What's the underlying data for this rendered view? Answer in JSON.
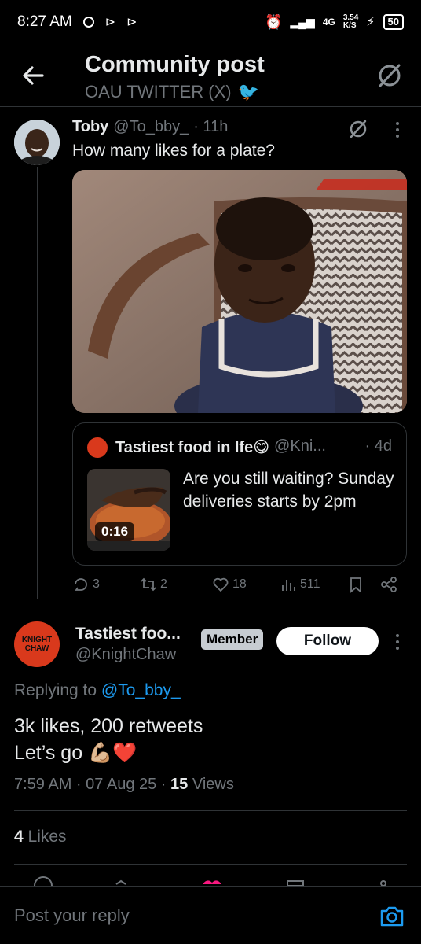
{
  "status_bar": {
    "time": "8:27 AM",
    "network": "4G",
    "speed": "3.54",
    "speed_unit": "K/S",
    "battery": "50"
  },
  "header": {
    "title": "Community post",
    "community": "OAU TWITTER (X)",
    "community_emoji": "🐦"
  },
  "tweet": {
    "name": "Toby",
    "handle": "@To_bby_",
    "time": "· 11h",
    "text": "How many likes for a plate?",
    "quote": {
      "name": "Tastiest food in Ife😋",
      "handle": "@Kni...",
      "time": "· 4d",
      "text": "Are you still waiting? Sunday deliveries starts by 2pm",
      "video_duration": "0:16"
    },
    "stats": {
      "replies": "3",
      "retweets": "2",
      "likes": "18",
      "views": "511"
    }
  },
  "reply": {
    "name": "Tastiest foo...",
    "handle": "@KnightChaw",
    "badge": "Member",
    "follow_label": "Follow",
    "avatar_text": "KNIGHT CHAW",
    "replying_prefix": "Replying to",
    "replying_handle": "@To_bby_",
    "line1": "3k likes, 200 retweets",
    "line2": "Let’s go 💪🏼❤️",
    "time": "7:59 AM · 07 Aug 25 ·",
    "views_count": "15",
    "views_label": "Views",
    "likes_count": "4",
    "likes_label": "Likes"
  },
  "composer": {
    "placeholder": "Post your reply"
  },
  "colors": {
    "accent": "#1d9bf0",
    "muted": "#71767b",
    "brand_red": "#d9391c"
  }
}
